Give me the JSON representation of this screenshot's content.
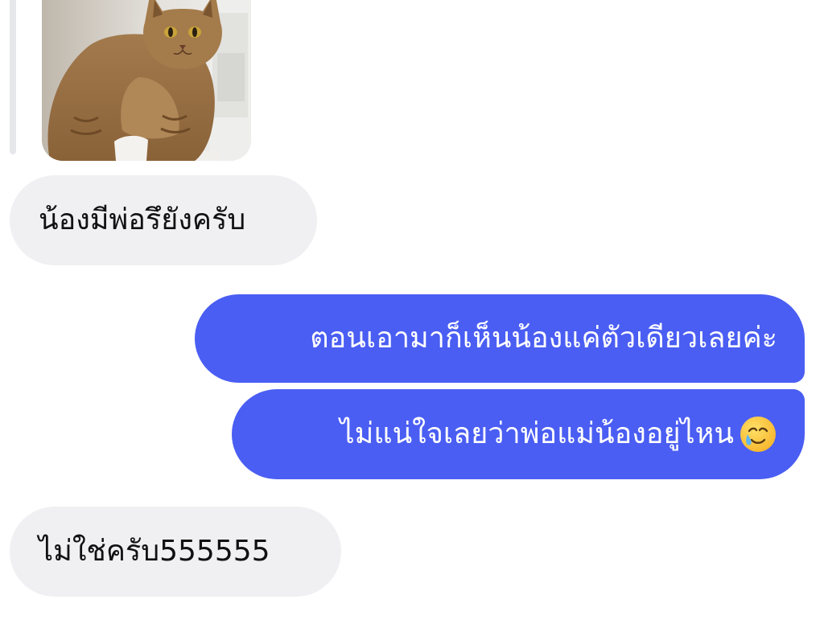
{
  "conversation": {
    "photo": {
      "subject": "cat photo",
      "kind": "image"
    },
    "messages": [
      {
        "sender": "them",
        "text": "น้องมีพ่อรึยังครับ"
      },
      {
        "sender": "me",
        "text": "ตอนเอามาก็เห็นน้องแค่ตัวเดียวเลยค่ะ"
      },
      {
        "sender": "me",
        "text": "ไม่แน่ใจเลยว่าพ่อแม่น้องอยู่ไหน",
        "emoji": "smiling-face-with-tear-icon"
      },
      {
        "sender": "them",
        "text": "ไม่ใช่ครับ555555"
      }
    ]
  },
  "colors": {
    "outgoing_bubble": "#4a5ef3",
    "incoming_bubble": "#f0f0f3",
    "background": "#ffffff"
  }
}
